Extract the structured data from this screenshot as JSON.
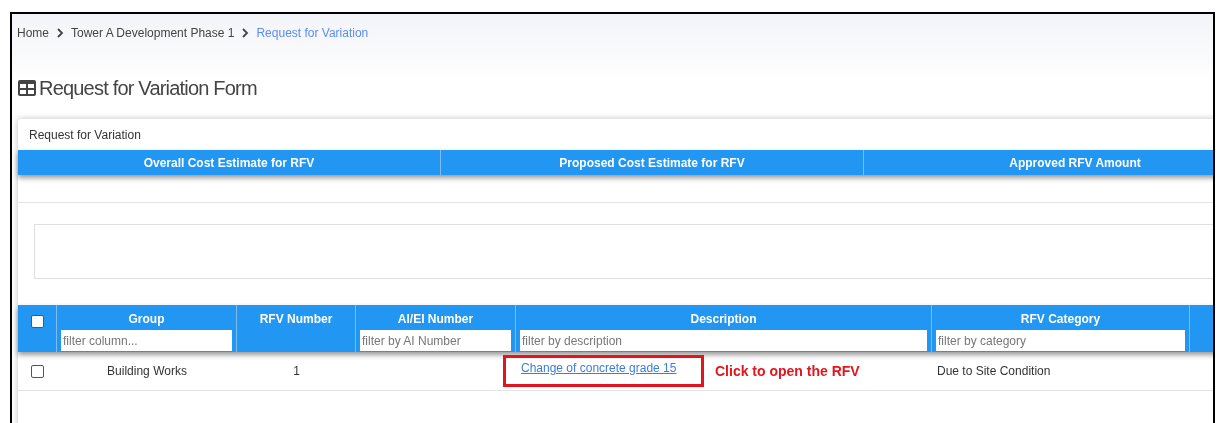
{
  "breadcrumb": [
    {
      "label": "Home",
      "current": false
    },
    {
      "label": "Tower A Development Phase 1",
      "current": false
    },
    {
      "label": "Request for Variation",
      "current": true
    }
  ],
  "page_title": "Request for Variation Form",
  "card": {
    "title": "Request for Variation",
    "summary_columns": [
      "Overall Cost Estimate for RFV",
      "Proposed Cost Estimate for RFV",
      "Approved RFV Amount"
    ],
    "table": {
      "select_all_checked": false,
      "columns": [
        {
          "label": "Group",
          "filter_placeholder": "filter column..."
        },
        {
          "label": "RFV Number"
        },
        {
          "label": "AI/EI Number",
          "filter_placeholder": "filter by AI Number"
        },
        {
          "label": "Description",
          "filter_placeholder": "filter by description"
        },
        {
          "label": "RFV Category",
          "filter_placeholder": "filter by category"
        }
      ],
      "rows": [
        {
          "checked": false,
          "group": "Building Works",
          "rfv_number": "1",
          "description": "Change of concrete grade 15",
          "category": "Due to Site Condition"
        }
      ]
    }
  },
  "annotation": {
    "text": "Click to open the RFV"
  }
}
